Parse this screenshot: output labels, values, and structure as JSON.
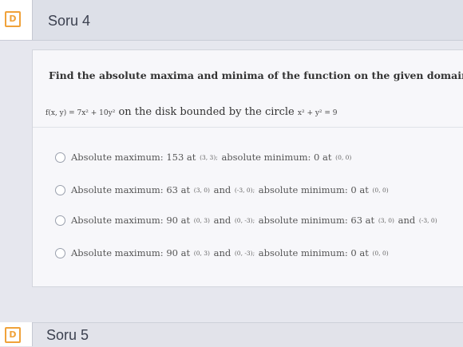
{
  "question4": {
    "title": "Soru 4",
    "prompt": "Find the absolute maxima and minima of the function on the given domain.",
    "function_formula": "f(x, y) = 7x² + 10y²",
    "function_text": "on the disk bounded by the circle",
    "circle_formula": "x² + y² = 9",
    "options": [
      {
        "text1": "Absolute maximum: 153 at",
        "pt1": "(3, 3);",
        "text2": "absolute minimum: 0 at",
        "pt2": "(0, 0)"
      },
      {
        "text1": "Absolute maximum: 63 at",
        "pt1": "(3, 0)",
        "text2": "and",
        "pt2": "(-3, 0);",
        "text3": "absolute minimum: 0 at",
        "pt3": "(0, 0)"
      },
      {
        "text1": "Absolute maximum: 90 at",
        "pt1": "(0, 3)",
        "text2": "and",
        "pt2": "(0, -3);",
        "text3": "absolute minimum: 63 at",
        "pt3": "(3, 0)",
        "text4": "and",
        "pt4": "(-3, 0)"
      },
      {
        "text1": "Absolute maximum: 90 at",
        "pt1": "(0, 3)",
        "text2": "and",
        "pt2": "(0, -3);",
        "text3": "absolute minimum: 0 at",
        "pt3": "(0, 0)"
      }
    ]
  },
  "question5": {
    "title": "Soru 5"
  },
  "flag_icon_letter": "D",
  "colors": {
    "flag": "#f0a23a",
    "header": "#dde0e8",
    "card": "#f7f7fa"
  }
}
